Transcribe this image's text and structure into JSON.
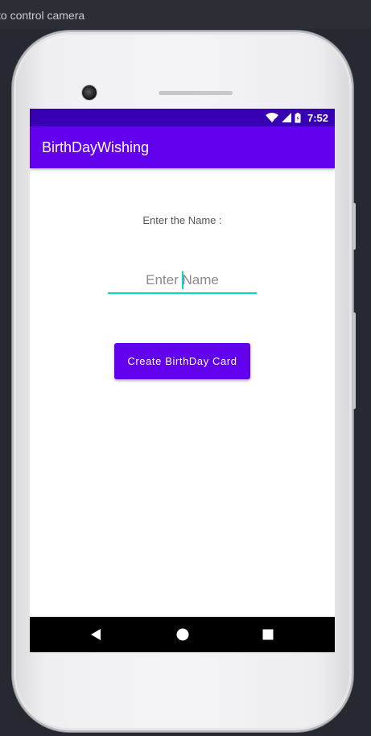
{
  "emulator": {
    "hint_text": "to control camera"
  },
  "status_bar": {
    "time": "7:52",
    "icons": [
      "wifi-icon",
      "cell-signal-icon",
      "battery-icon"
    ]
  },
  "app_bar": {
    "title": "BirthDayWishing"
  },
  "form": {
    "label": "Enter the Name :",
    "name_input": {
      "value": "",
      "placeholder": "Enter Name"
    },
    "create_button_label": "Create BirthDay Card"
  },
  "nav_bar": {
    "icons": [
      "back-icon",
      "home-icon",
      "recents-icon"
    ]
  },
  "colors": {
    "primary": "#6200ee",
    "primary_dark": "#3700b3",
    "accent": "#03dac5"
  }
}
